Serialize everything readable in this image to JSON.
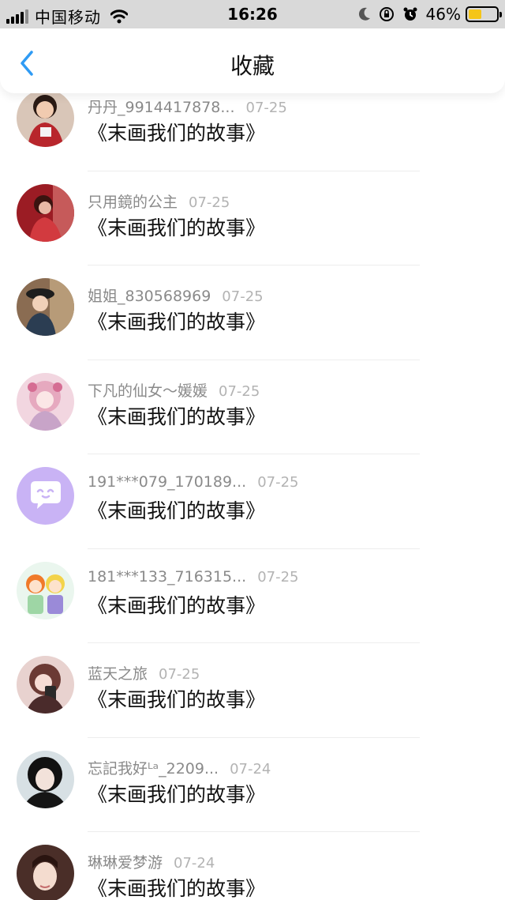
{
  "status_bar": {
    "carrier": "中国移动",
    "time": "16:26",
    "battery_percent": "46%",
    "battery_level": 0.46,
    "battery_color": "#f5c518"
  },
  "nav": {
    "back_icon": "chevron-left-icon",
    "title": "收藏",
    "accent_color": "#2f9bf4"
  },
  "items": [
    {
      "name": "丹丹_9914417878...",
      "date": "07-25",
      "content": "《末画我们的故事》",
      "avatar": "photo-girl-red"
    },
    {
      "name": "只用鏡的公主",
      "date": "07-25",
      "content": "《末画我们的故事》",
      "avatar": "photo-red-dress"
    },
    {
      "name": "姐姐_830568969",
      "date": "07-25",
      "content": "《末画我们的故事》",
      "avatar": "photo-woman-hat"
    },
    {
      "name": "下凡的仙女～媛媛",
      "date": "07-25",
      "content": "《末画我们的故事》",
      "avatar": "anime-pink"
    },
    {
      "name": "191***079_170189...",
      "date": "07-25",
      "content": "《末画我们的故事》",
      "avatar": "chat-bubble-icon"
    },
    {
      "name": "181***133_716315...",
      "date": "07-25",
      "content": "《末画我们的故事》",
      "avatar": "anime-two-kids"
    },
    {
      "name": "蓝天之旅",
      "date": "07-25",
      "content": "《末画我们的故事》",
      "avatar": "anime-girl-phone"
    },
    {
      "name": "忘記我好ᴸᵃ_2209...",
      "date": "07-24",
      "content": "《末画我们的故事》",
      "avatar": "photo-girl-dark"
    },
    {
      "name": "琳琳爱梦游",
      "date": "07-24",
      "content": "《末画我们的故事》",
      "avatar": "photo-girl-smile"
    }
  ]
}
